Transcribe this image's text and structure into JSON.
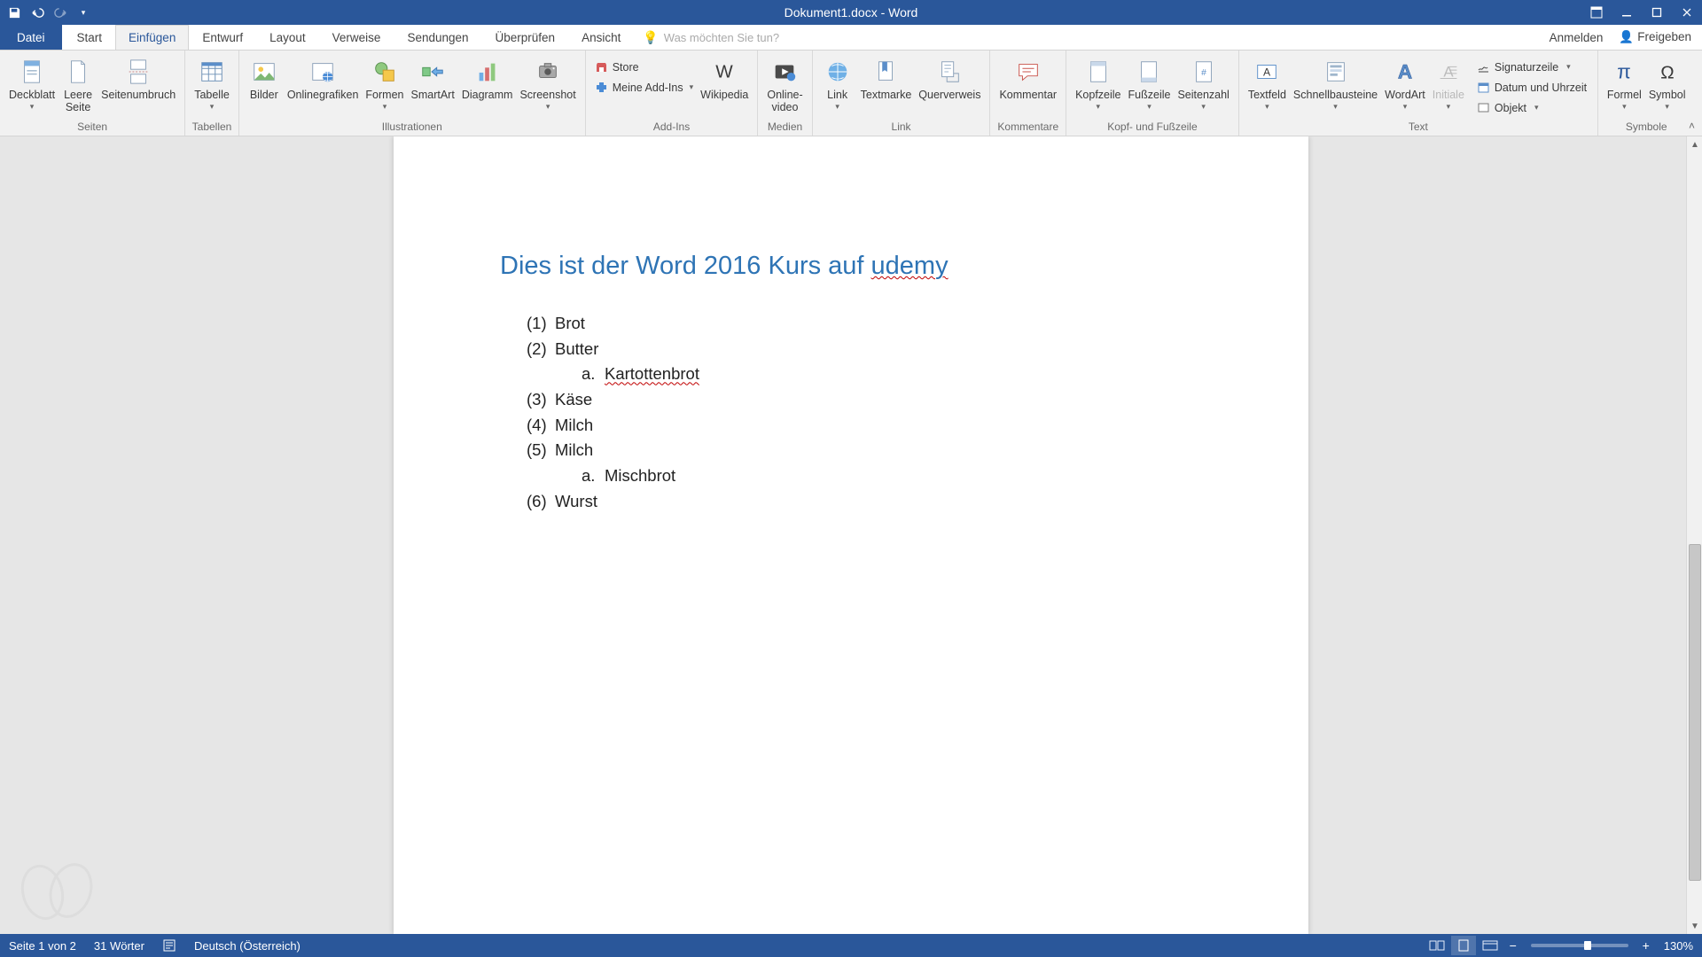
{
  "titlebar": {
    "title": "Dokument1.docx - Word"
  },
  "tabs": {
    "file": "Datei",
    "items": [
      "Start",
      "Einfügen",
      "Entwurf",
      "Layout",
      "Verweise",
      "Sendungen",
      "Überprüfen",
      "Ansicht"
    ],
    "active_index": 1,
    "tellme_placeholder": "Was möchten Sie tun?",
    "sign_in": "Anmelden",
    "share": "Freigeben"
  },
  "ribbon": {
    "groups": {
      "seiten": {
        "label": "Seiten",
        "deckblatt": "Deckblatt",
        "leere_seite": "Leere\nSeite",
        "seitenumbruch": "Seitenumbruch"
      },
      "tabellen": {
        "label": "Tabellen",
        "tabelle": "Tabelle"
      },
      "illustrationen": {
        "label": "Illustrationen",
        "bilder": "Bilder",
        "onlinegrafiken": "Onlinegrafiken",
        "formen": "Formen",
        "smartart": "SmartArt",
        "diagramm": "Diagramm",
        "screenshot": "Screenshot"
      },
      "addins": {
        "label": "Add-Ins",
        "store": "Store",
        "meine_addins": "Meine Add-Ins",
        "wikipedia": "Wikipedia"
      },
      "medien": {
        "label": "Medien",
        "onlinevideo": "Online-\nvideo"
      },
      "link": {
        "label": "Link",
        "link": "Link",
        "textmarke": "Textmarke",
        "querverweis": "Querverweis"
      },
      "kommentare": {
        "label": "Kommentare",
        "kommentar": "Kommentar"
      },
      "kopffuss": {
        "label": "Kopf- und Fußzeile",
        "kopfzeile": "Kopfzeile",
        "fusszeile": "Fußzeile",
        "seitenzahl": "Seitenzahl"
      },
      "text": {
        "label": "Text",
        "textfeld": "Textfeld",
        "schnellbausteine": "Schnellbausteine",
        "wordart": "WordArt",
        "initiale": "Initiale",
        "signaturzeile": "Signaturzeile",
        "datum_uhrzeit": "Datum und Uhrzeit",
        "objekt": "Objekt"
      },
      "symbole": {
        "label": "Symbole",
        "formel": "Formel",
        "symbol": "Symbol"
      }
    }
  },
  "document": {
    "heading_plain": "Dies ist der Word 2016 Kurs auf ",
    "heading_err": "udemy",
    "list": [
      {
        "n": "(1)",
        "text": "Brot"
      },
      {
        "n": "(2)",
        "text": "Butter",
        "sub": {
          "k": "a.",
          "text": "Kartottenbrot",
          "spellerr": true
        }
      },
      {
        "n": "(3)",
        "text": "Käse"
      },
      {
        "n": "(4)",
        "text": "Milch"
      },
      {
        "n": "(5)",
        "text": "Milch",
        "sub": {
          "k": "a.",
          "text": "Mischbrot",
          "spellerr": false
        }
      },
      {
        "n": "(6)",
        "text": "Wurst"
      }
    ]
  },
  "statusbar": {
    "page": "Seite 1 von 2",
    "words": "31 Wörter",
    "language": "Deutsch (Österreich)",
    "zoom": "130%"
  }
}
